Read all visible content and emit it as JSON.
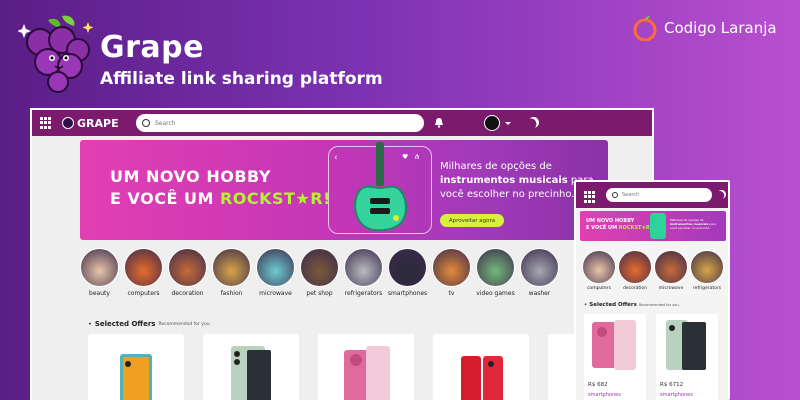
{
  "hero": {
    "title": "Grape",
    "subtitle": "Affiliate link sharing platform"
  },
  "brand": {
    "name": "Codigo Laranja"
  },
  "nav": {
    "logo_text": "GRAPE",
    "search_placeholder": "Search"
  },
  "banner": {
    "headline_line1": "UM NOVO HOBBY",
    "headline_line2_prefix": "E VOCÊ UM ",
    "headline_highlight": "ROCKST★R!",
    "text_part1": "Milhares de opções de ",
    "text_bold": "instrumentos musicais",
    "text_part2": " para você escolher no precinho.",
    "button_label": "Aproveitar agora"
  },
  "categories": [
    "beauty",
    "computers",
    "decoration",
    "fashion",
    "microwave",
    "pet shop",
    "refrigerators",
    "smartphones",
    "tv",
    "video games",
    "washer"
  ],
  "selected": {
    "title": "Selected Offers",
    "subtitle": "Recommended for you."
  },
  "mobile": {
    "search_placeholder": "Search",
    "categories": [
      "computers",
      "decoration",
      "microwave",
      "refrigerators"
    ],
    "cards": [
      {
        "price": "R$ 682",
        "category": "smartphones"
      },
      {
        "price": "R$ 6712",
        "category": "smartphones"
      }
    ]
  },
  "colors": {
    "nav": "#7c1a6e",
    "accent_green": "#b7f232",
    "banner_pink": "#e23fb2"
  }
}
